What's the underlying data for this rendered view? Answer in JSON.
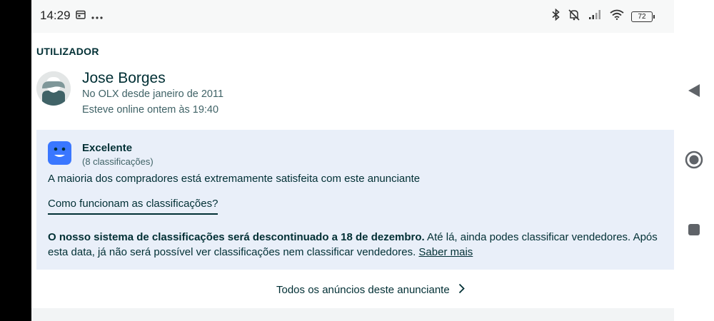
{
  "status_bar": {
    "time": "14:29",
    "battery": "72",
    "icons": [
      "calendar-icon",
      "more-dots-icon",
      "bluetooth-icon",
      "vibrate-icon",
      "signal-icon",
      "wifi-icon",
      "battery-icon"
    ]
  },
  "user": {
    "section_title": "UTILIZADOR",
    "name": "Jose Borges",
    "since": "No OLX desde janeiro de 2011",
    "online": "Esteve online ontem às 19:40"
  },
  "rating": {
    "title": "Excelente",
    "count": "(8 classificações)",
    "description": "A maioria dos compradores está extremamente satisfeita com este anunciante",
    "how_link": "Como funcionam as classificações?",
    "notice_bold": "O nosso sistema de classificações será descontinuado a 18 de dezembro.",
    "notice_text": " Até lá, ainda podes classificar vendedores. Após esta data, já não será possível ver classificações nem classificar vendedores. ",
    "learn_more": "Saber mais",
    "accent_color": "#3a77ff"
  },
  "all_ads_link": "Todos os anúncios deste anunciante",
  "nav_buttons": [
    "back-icon",
    "home-icon",
    "recents-icon"
  ]
}
